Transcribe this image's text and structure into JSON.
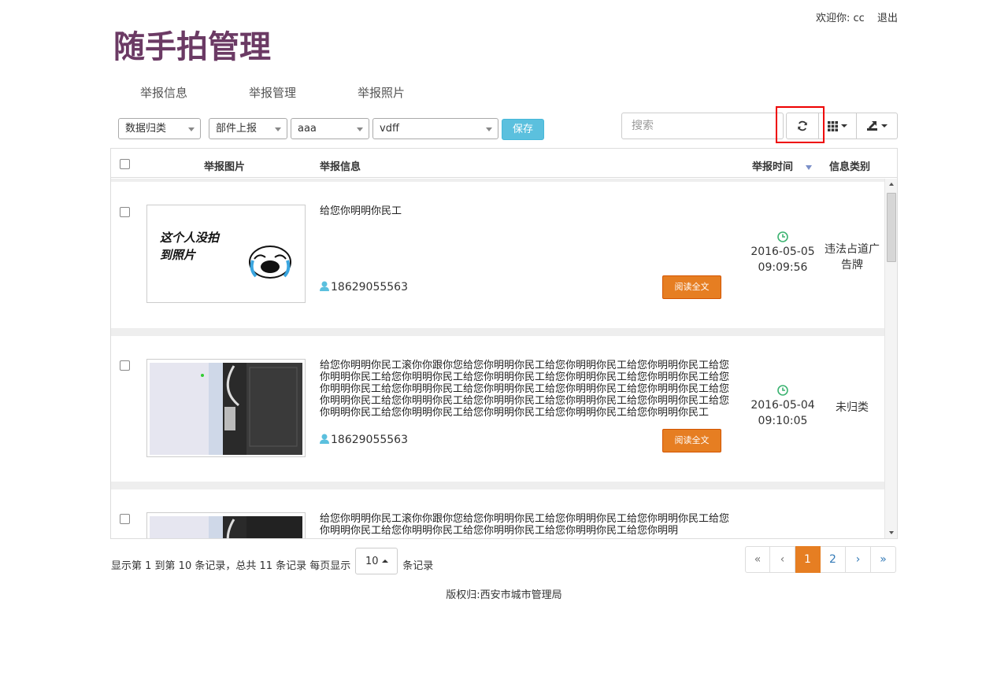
{
  "user_bar": {
    "welcome": "欢迎你: cc",
    "logout": "退出"
  },
  "logo": {
    "text": "随手拍管理"
  },
  "nav": {
    "items": [
      "举报信息",
      "举报管理",
      "举报照片"
    ]
  },
  "toolbar": {
    "select1": "数据归类",
    "select2": "部件上报",
    "select3": "aaa",
    "select4": "vdff",
    "save_label": "保存",
    "search_placeholder": "搜索"
  },
  "table": {
    "headers": {
      "photo": "举报图片",
      "info": "举报信息",
      "time": "举报时间",
      "category": "信息类别"
    },
    "rows": [
      {
        "photo_text_line1": "这个人没拍",
        "photo_text_line2": "到照片",
        "message": "给您你明明你民工",
        "phone": "18629055563",
        "read_label": "阅读全文",
        "date": "2016-05-05",
        "clock": "09:09:56",
        "category": "违法占道广告牌"
      },
      {
        "message": "给您你明明你民工滚你你跟你您给您你明明你民工给您你明明你民工给您你明明你民工给您你明明你民工给您你明明你民工给您你明明你民工给您你明明你民工给您你明明你民工给您你明明你民工给您你明明你民工给您你明明你民工给您你明明你民工给您你明明你民工给您你明明你民工给您你明明你民工给您你明明你民工给您你明明你民工给您你明明你民工给您你明明你民工给您你明明你民工给您你明明你民工给您你明明你民工给您你明明你民工",
        "phone": "18629055563",
        "read_label": "阅读全文",
        "date": "2016-05-04",
        "clock": "09:10:05",
        "category": "未归类"
      },
      {
        "message": "给您你明明你民工滚你你跟你您给您你明明你民工给您你明明你民工给您你明明你民工给您你明明你民工给您你明明你民工给您你明明你民工给您你明明你民工给您你明明"
      }
    ]
  },
  "pager": {
    "info_prefix": "显示第 1 到第 10 条记录，总共 11 条记录 每页显示",
    "page_size": "10",
    "info_suffix": "条记录",
    "pages": [
      "«",
      "‹",
      "1",
      "2",
      "›",
      "»"
    ]
  },
  "footer": {
    "copyright": "版权归:西安市城市管理局"
  },
  "colors": {
    "accent": "#e67e22",
    "save": "#5bc0de",
    "logo": "#6b3a64",
    "highlight": "#e00000"
  }
}
